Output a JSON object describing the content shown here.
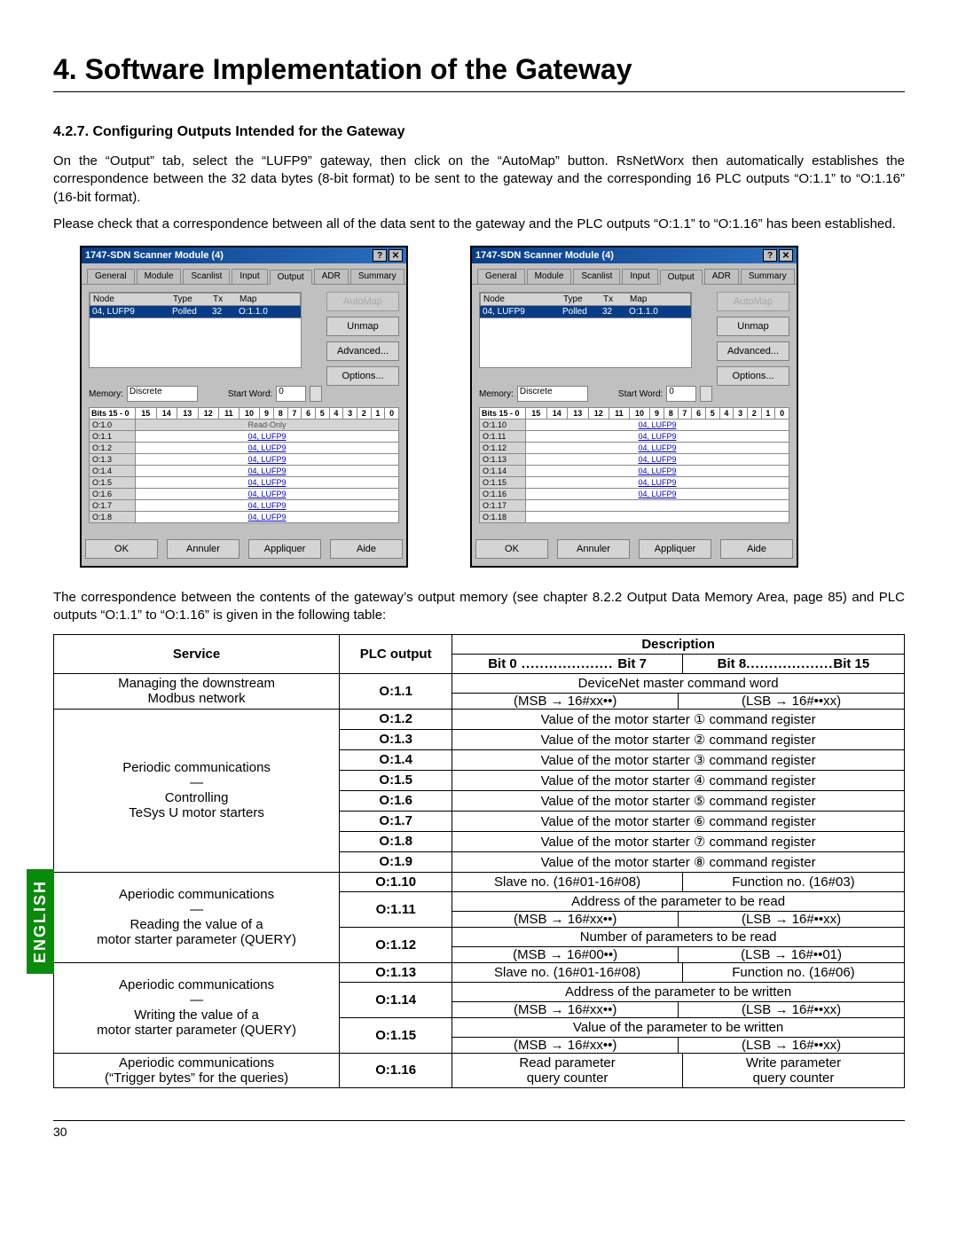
{
  "title": "4. Software Implementation of the Gateway",
  "section": "4.2.7. Configuring Outputs Intended for the Gateway",
  "para1": "On the “Output” tab, select the “LUFP9” gateway, then click on the “AutoMap” button. RsNetWorx then automatically establishes the correspondence between the 32 data bytes (8-bit format) to be sent to the gateway and the corresponding 16 PLC outputs “O:1.1” to “O:1.16” (16-bit format).",
  "para2": "Please check that a correspondence between all of the data sent to the gateway and the PLC outputs “O:1.1” to “O:1.16” has been established.",
  "para3": "The correspondence between the contents of the gateway’s output memory (see chapter 8.2.2 Output Data Memory Area, page 85) and PLC outputs “O:1.1” to “O:1.16” is given in the following table:",
  "dialog": {
    "title": "1747-SDN Scanner Module (4)",
    "help": "?",
    "close": "✕",
    "tabs": [
      "General",
      "Module",
      "Scanlist",
      "Input",
      "Output",
      "ADR",
      "Summary"
    ],
    "active_tab": "Output",
    "cols": {
      "node": "Node",
      "type": "Type",
      "tx": "Tx",
      "map": "Map"
    },
    "row": {
      "node": "04, LUFP9",
      "type": "Polled",
      "tx": "32",
      "map": "O:1.1.0"
    },
    "buttons": {
      "automap": "AutoMap",
      "unmap": "Unmap",
      "advanced": "Advanced...",
      "options": "Options..."
    },
    "memory_label": "Memory:",
    "memory_value": "Discrete",
    "startword_label": "Start Word:",
    "startword_value": "0",
    "bits_header": "Bits 15 - 0",
    "bit_nums": [
      "15",
      "14",
      "13",
      "12",
      "11",
      "10",
      "9",
      "8",
      "7",
      "6",
      "5",
      "4",
      "3",
      "2",
      "1",
      "0"
    ],
    "left_rows": [
      {
        "addr": "O:1.0",
        "val": "Read-Only",
        "ro": true
      },
      {
        "addr": "O:1.1",
        "val": "04, LUFP9"
      },
      {
        "addr": "O:1.2",
        "val": "04, LUFP9"
      },
      {
        "addr": "O:1.3",
        "val": "04, LUFP9"
      },
      {
        "addr": "O:1.4",
        "val": "04, LUFP9"
      },
      {
        "addr": "O:1.5",
        "val": "04, LUFP9"
      },
      {
        "addr": "O:1.6",
        "val": "04, LUFP9"
      },
      {
        "addr": "O:1.7",
        "val": "04, LUFP9"
      },
      {
        "addr": "O:1.8",
        "val": "04, LUFP9"
      }
    ],
    "right_rows": [
      {
        "addr": "O:1.10",
        "val": "04, LUFP9"
      },
      {
        "addr": "O:1.11",
        "val": "04, LUFP9"
      },
      {
        "addr": "O:1.12",
        "val": "04, LUFP9"
      },
      {
        "addr": "O:1.13",
        "val": "04, LUFP9"
      },
      {
        "addr": "O:1.14",
        "val": "04, LUFP9"
      },
      {
        "addr": "O:1.15",
        "val": "04, LUFP9"
      },
      {
        "addr": "O:1.16",
        "val": "04, LUFP9"
      },
      {
        "addr": "O:1.17",
        "val": ""
      },
      {
        "addr": "O:1.18",
        "val": ""
      }
    ],
    "bottom": {
      "ok": "OK",
      "cancel": "Annuler",
      "apply": "Appliquer",
      "help_btn": "Aide"
    }
  },
  "lang_tab": "ENGLISH",
  "table": {
    "head": {
      "service": "Service",
      "plc": "PLC output",
      "desc": "Description",
      "bit0": "Bit 0",
      "bit7": "Bit 7",
      "bit8": "Bit 8",
      "bit15": "Bit 15"
    },
    "r1": {
      "service_l1": "Managing the downstream",
      "service_l2": "Modbus network",
      "plc": "O:1.1",
      "top": "DeviceNet master command word",
      "left": "(MSB → 16#xx••)",
      "right": "(LSB → 16#••xx)"
    },
    "r2": {
      "service_l1": "Periodic communications",
      "service_l2": "—",
      "service_l3": "Controlling",
      "service_l4": "TeSys U motor starters",
      "rows": [
        {
          "plc": "O:1.2",
          "desc": "Value of the motor starter ① command register"
        },
        {
          "plc": "O:1.3",
          "desc": "Value of the motor starter ② command register"
        },
        {
          "plc": "O:1.4",
          "desc": "Value of the motor starter ③ command register"
        },
        {
          "plc": "O:1.5",
          "desc": "Value of the motor starter ④ command register"
        },
        {
          "plc": "O:1.6",
          "desc": "Value of the motor starter ⑤ command register"
        },
        {
          "plc": "O:1.7",
          "desc": "Value of the motor starter ⑥ command register"
        },
        {
          "plc": "O:1.8",
          "desc": "Value of the motor starter ⑦ command register"
        },
        {
          "plc": "O:1.9",
          "desc": "Value of the motor starter ⑧ command register"
        }
      ]
    },
    "r3": {
      "service_l1": "Aperiodic communications",
      "service_l2": "—",
      "service_l3": "Reading the value of a",
      "service_l4": "motor starter parameter (QUERY)",
      "r10": {
        "plc": "O:1.10",
        "left": "Slave no. (16#01-16#08)",
        "right": "Function no. (16#03)"
      },
      "r11": {
        "plc": "O:1.11",
        "top": "Address of the parameter to be read",
        "left": "(MSB → 16#xx••)",
        "right": "(LSB → 16#••xx)"
      },
      "r12": {
        "plc": "O:1.12",
        "top": "Number of parameters to be read",
        "left": "(MSB → 16#00••)",
        "right": "(LSB → 16#••01)"
      }
    },
    "r4": {
      "service_l1": "Aperiodic communications",
      "service_l2": "—",
      "service_l3": "Writing the value of a",
      "service_l4": "motor starter parameter (QUERY)",
      "r13": {
        "plc": "O:1.13",
        "left": "Slave no. (16#01-16#08)",
        "right": "Function no. (16#06)"
      },
      "r14": {
        "plc": "O:1.14",
        "top": "Address of the parameter to be written",
        "left": "(MSB → 16#xx••)",
        "right": "(LSB → 16#••xx)"
      },
      "r15": {
        "plc": "O:1.15",
        "top": "Value of the parameter to be written",
        "left": "(MSB → 16#xx••)",
        "right": "(LSB → 16#••xx)"
      }
    },
    "r5": {
      "service_l1": "Aperiodic communications",
      "service_l2": "(“Trigger bytes” for the queries)",
      "plc": "O:1.16",
      "left_l1": "Read parameter",
      "left_l2": "query counter",
      "right_l1": "Write parameter",
      "right_l2": "query counter"
    }
  },
  "page_number": "30"
}
